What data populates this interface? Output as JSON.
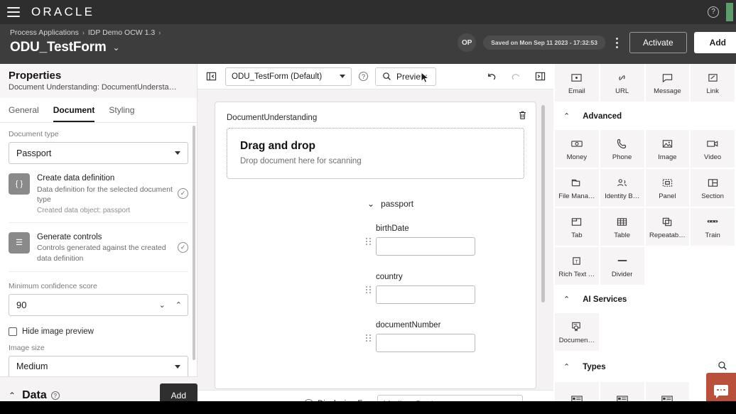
{
  "topbar": {
    "menu_icon": "hamburger-icon",
    "logo": "ORACLE",
    "help_icon": "help-circle-icon"
  },
  "header": {
    "breadcrumb": [
      {
        "label": "Process Applications"
      },
      {
        "label": "IDP Demo OCW 1.3"
      }
    ],
    "breadcrumb_sep": "›",
    "title": "ODU_TestForm",
    "title_caret": "⌄",
    "avatar_initials": "OP",
    "saved_status": "Saved on Mon Sep 11 2023 - 17:32:53",
    "kebab_icon": "more-vertical-icon",
    "activate_label": "Activate",
    "add_label": "Add"
  },
  "properties": {
    "title": "Properties",
    "subtitle": "Document Understanding: DocumentUndersta…",
    "tabs": [
      {
        "label": "General",
        "active": false
      },
      {
        "label": "Document",
        "active": true
      },
      {
        "label": "Styling",
        "active": false
      }
    ],
    "document_type_label": "Document type",
    "document_type_value": "Passport",
    "tasks": [
      {
        "icon": "braces-icon",
        "icon_glyph": "{ }",
        "title": "Create data definition",
        "desc": "Data definition for the selected document type",
        "extra": "Created data object: passport",
        "status_icon": "check-circle-icon",
        "status_glyph": "✓"
      },
      {
        "icon": "list-panel-icon",
        "icon_glyph": "☰",
        "title": "Generate controls",
        "desc": "Controls generated against the created data definition",
        "extra": "",
        "status_icon": "check-circle-icon",
        "status_glyph": "✓"
      }
    ],
    "confidence_label": "Minimum confidence score",
    "confidence_value": "90",
    "stepper_down": "⌄",
    "stepper_up": "⌃",
    "hide_preview_label": "Hide image preview",
    "image_size_label": "Image size",
    "image_size_value": "Medium"
  },
  "data_section": {
    "caret": "⌃",
    "title": "Data",
    "help_icon": "help-circle-icon",
    "add_label": "Add"
  },
  "canvas_toolbar": {
    "collapse_left_icon": "panel-collapse-left-icon",
    "form_select_value": "ODU_TestForm (Default)",
    "help_icon": "help-circle-icon",
    "preview_label": "Preview",
    "preview_icon": "search-icon",
    "undo_icon": "undo-icon",
    "redo_icon": "redo-icon",
    "collapse_right_icon": "panel-collapse-right-icon"
  },
  "canvas": {
    "delete_icon": "trash-icon",
    "component_label": "DocumentUnderstanding",
    "dropzone_title": "Drag and drop",
    "dropzone_subtitle": "Drop document here for scanning",
    "section_caret": "⌄",
    "section_label": "passport",
    "fields": [
      {
        "label": "birthDate",
        "value": ""
      },
      {
        "label": "country",
        "value": ""
      },
      {
        "label": "documentNumber",
        "value": ""
      }
    ],
    "displaying_for_label": "Displaying For",
    "displaying_for_icon": "info-circle-icon",
    "device_value": "Medium Devices"
  },
  "palette": {
    "top_items": [
      {
        "label": "Email",
        "icon": "email-icon"
      },
      {
        "label": "URL",
        "icon": "url-icon"
      },
      {
        "label": "Message",
        "icon": "message-icon"
      },
      {
        "label": "Link",
        "icon": "link-icon"
      }
    ],
    "groups": [
      {
        "name": "Advanced",
        "caret": "⌃",
        "has_search": false,
        "items": [
          {
            "label": "Money",
            "icon": "money-icon"
          },
          {
            "label": "Phone",
            "icon": "phone-icon"
          },
          {
            "label": "Image",
            "icon": "image-icon"
          },
          {
            "label": "Video",
            "icon": "video-icon"
          },
          {
            "label": "File Mana…",
            "icon": "folder-icon"
          },
          {
            "label": "Identity B…",
            "icon": "identity-icon"
          },
          {
            "label": "Panel",
            "icon": "panel-icon"
          },
          {
            "label": "Section",
            "icon": "section-icon"
          },
          {
            "label": "Tab",
            "icon": "tab-icon"
          },
          {
            "label": "Table",
            "icon": "table-icon"
          },
          {
            "label": "Repeatab…",
            "icon": "repeatable-icon"
          },
          {
            "label": "Train",
            "icon": "train-icon"
          },
          {
            "label": "Rich Text …",
            "icon": "rich-text-icon"
          },
          {
            "label": "Divider",
            "icon": "divider-icon"
          }
        ]
      },
      {
        "name": "AI Services",
        "caret": "⌃",
        "has_search": false,
        "items": [
          {
            "label": "Documen…",
            "icon": "document-understanding-icon"
          }
        ]
      },
      {
        "name": "Types",
        "caret": "⌃",
        "has_search": true,
        "search_icon": "search-icon",
        "items": [
          {
            "label": "",
            "icon": "type-card-icon"
          },
          {
            "label": "",
            "icon": "type-card-icon"
          },
          {
            "label": "",
            "icon": "type-card-icon"
          }
        ]
      }
    ]
  },
  "feedback": {
    "icon": "chat-bubble-icon"
  },
  "colors": {
    "topbar_bg": "#2e2e2e",
    "header_bg": "#3d3d3d",
    "canvas_bg": "#f4f2f3",
    "palette_tile": "#f6f4f5",
    "accent_red": "#b9503c",
    "accent_green": "#5e9c6b"
  }
}
